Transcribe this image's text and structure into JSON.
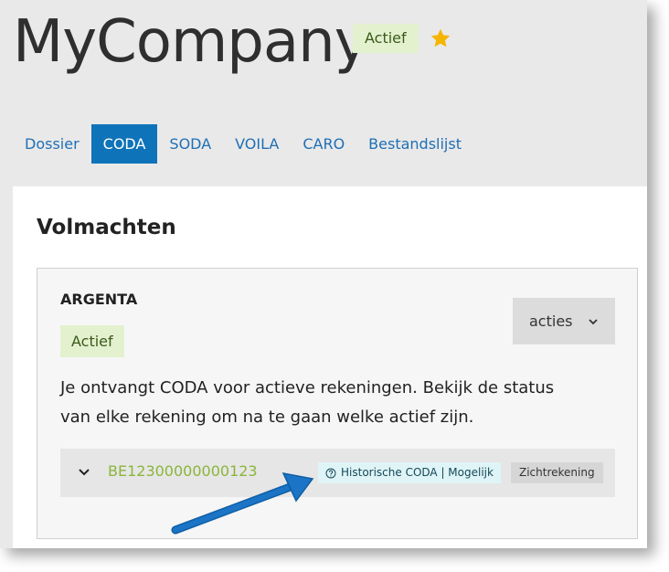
{
  "header": {
    "company_name": "MyCompany",
    "status": "Actief",
    "favorite_icon": "star-icon"
  },
  "tabs": [
    {
      "label": "Dossier",
      "active": false
    },
    {
      "label": "CODA",
      "active": true
    },
    {
      "label": "SODA",
      "active": false
    },
    {
      "label": "VOILA",
      "active": false
    },
    {
      "label": "CARO",
      "active": false
    },
    {
      "label": "Bestandslijst",
      "active": false
    }
  ],
  "section": {
    "title": "Volmachten",
    "bank": {
      "name": "ARGENTA",
      "status": "Actief",
      "actions_label": "acties",
      "description": "Je ontvangt CODA voor actieve rekeningen. Bekijk de status van elke rekening om na te gaan welke actief zijn.",
      "account": {
        "iban": "BE12300000000123",
        "historic_tag": "Historische CODA | Mogelijk",
        "type_tag": "Zichtrekening"
      }
    }
  },
  "colors": {
    "accent": "#0f73b9",
    "active_badge_bg": "#e3f1cf",
    "iban_green": "#8bb53b",
    "star": "#f5b400",
    "annotation_arrow": "#1b74c5"
  }
}
